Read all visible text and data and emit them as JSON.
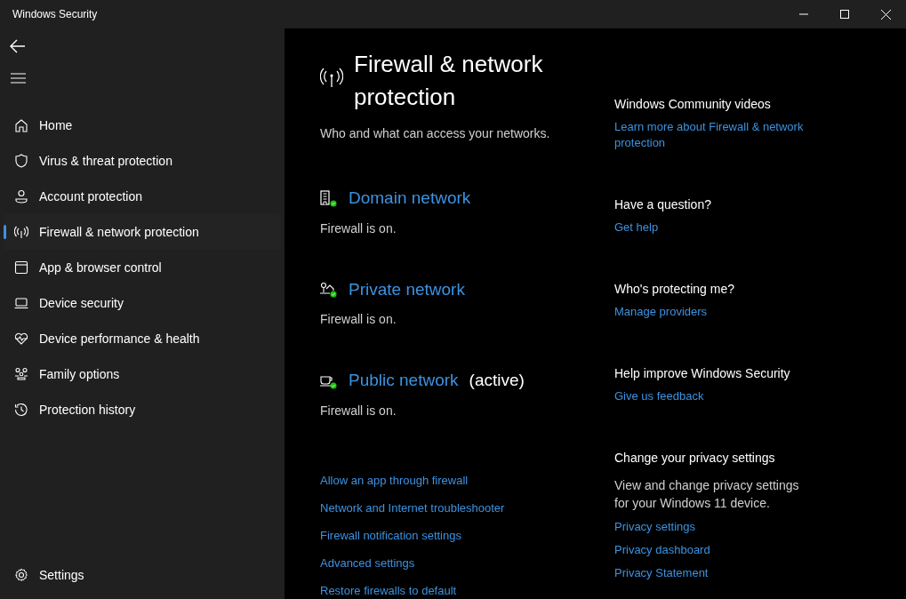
{
  "window": {
    "title": "Windows Security"
  },
  "nav": {
    "items": [
      {
        "label": "Home",
        "selected": false
      },
      {
        "label": "Virus & threat protection",
        "selected": false
      },
      {
        "label": "Account protection",
        "selected": false
      },
      {
        "label": "Firewall & network protection",
        "selected": true
      },
      {
        "label": "App & browser control",
        "selected": false
      },
      {
        "label": "Device security",
        "selected": false
      },
      {
        "label": "Device performance & health",
        "selected": false
      },
      {
        "label": "Family options",
        "selected": false
      },
      {
        "label": "Protection history",
        "selected": false
      }
    ],
    "settings": "Settings"
  },
  "page": {
    "title": "Firewall & network protection",
    "subtitle": "Who and what can access your networks.",
    "networks": [
      {
        "name": "Domain network",
        "status": "Firewall is on."
      },
      {
        "name": "Private network",
        "status": "Firewall is on."
      },
      {
        "name": "Public network",
        "badge": "(active)",
        "status": "Firewall is on."
      }
    ],
    "links": [
      "Allow an app through firewall",
      "Network and Internet troubleshooter",
      "Firewall notification settings",
      "Advanced settings",
      "Restore firewalls to default"
    ]
  },
  "side": [
    {
      "heading": "Windows Community videos",
      "links": [
        "Learn more about Firewall & network protection"
      ]
    },
    {
      "heading": "Have a question?",
      "links": [
        "Get help"
      ]
    },
    {
      "heading": "Who's protecting me?",
      "links": [
        "Manage providers"
      ]
    },
    {
      "heading": "Help improve Windows Security",
      "links": [
        "Give us feedback"
      ]
    },
    {
      "heading": "Change your privacy settings",
      "text": "View and change privacy settings for your Windows 11 device.",
      "links": [
        "Privacy settings",
        "Privacy dashboard",
        "Privacy Statement"
      ]
    }
  ]
}
